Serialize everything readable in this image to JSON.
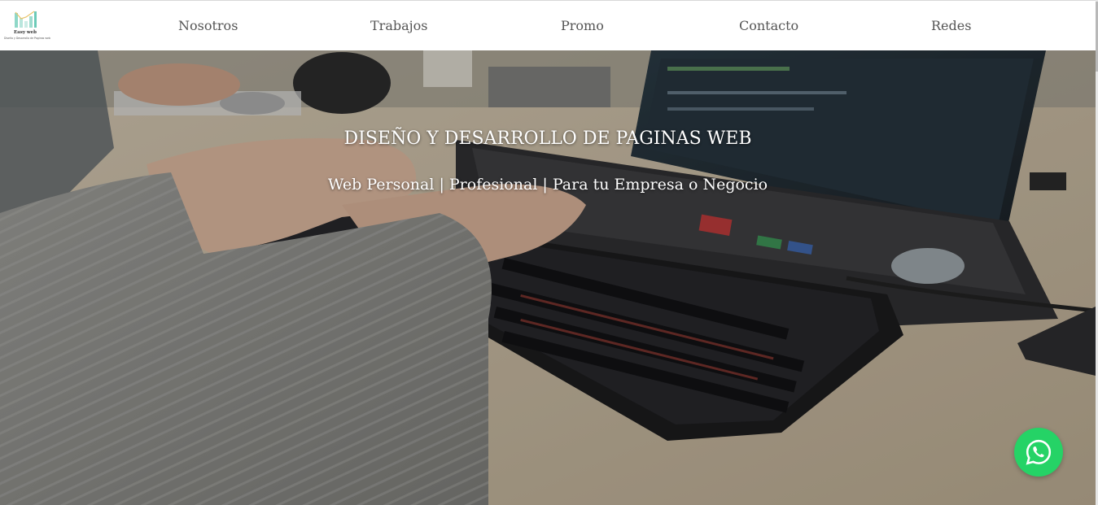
{
  "brand": {
    "name": "Easy web",
    "tagline": "Diseño y Desarrollo de Paginas web",
    "accent_color": "#7fd3c6"
  },
  "nav": {
    "items": [
      {
        "label": "Nosotros"
      },
      {
        "label": "Trabajos"
      },
      {
        "label": "Promo"
      },
      {
        "label": "Contacto"
      },
      {
        "label": "Redes"
      }
    ]
  },
  "hero": {
    "title": "DISEÑO Y DESARROLLO DE PAGINAS WEB",
    "subtitle": "Web Personal | Profesional | Para tu Empresa o Negocio",
    "background_icon": "keyboard-laptop-photo"
  },
  "whatsapp": {
    "icon": "whatsapp-icon",
    "color": "#25d366"
  }
}
